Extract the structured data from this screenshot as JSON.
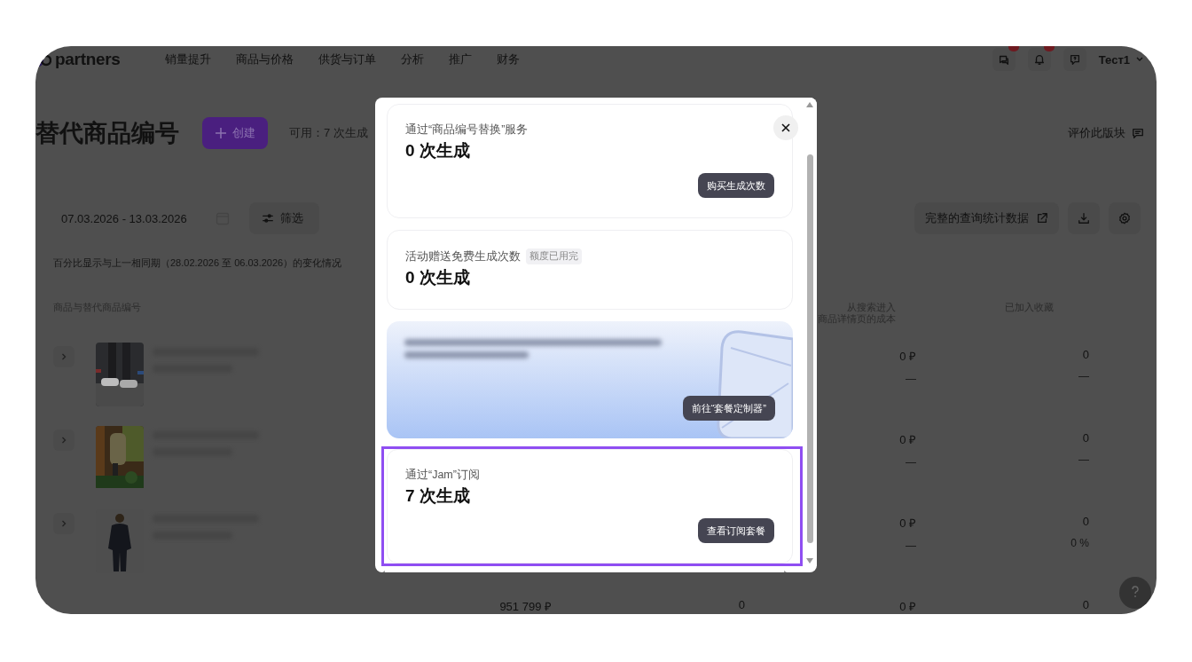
{
  "nav": {
    "logo": "partners",
    "items": [
      "销量提升",
      "商品与价格",
      "供货与订单",
      "分析",
      "推广",
      "财务"
    ],
    "user": "Тест1"
  },
  "page": {
    "title": "替代商品编号",
    "create_button": "创建",
    "available": "可用：7 次生成",
    "rate_link": "评价此版块"
  },
  "toolbar": {
    "date_range": "07.03.2026 - 13.03.2026",
    "filter_button": "筛选",
    "stats_button": "完整的查询统计数据"
  },
  "note": "百分比显示与上一相同期（28.02.2026 至 06.03.2026）的变化情况",
  "table": {
    "columns": [
      {
        "label": "商品与替代商品编号"
      },
      {
        "lines": [
          "从搜索进入",
          "商品详情页的成本"
        ]
      },
      {
        "label": "已加入收藏"
      }
    ],
    "rows": [
      {
        "cost": "0 ₽",
        "cost_change": "—",
        "favorites": "0",
        "favorites_change": "—"
      },
      {
        "cost": "0 ₽",
        "cost_change": "—",
        "favorites": "0",
        "favorites_change": "—"
      },
      {
        "cost": "0 ₽",
        "cost_change": "—",
        "favorites": "0",
        "favorites_change": "0 %"
      },
      {
        "column_4": "951 799 ₽",
        "column_5": "0",
        "cost": "0 ₽",
        "favorites": "0"
      }
    ]
  },
  "modal": {
    "cards": [
      {
        "kind": "balance",
        "label": "通过“商品编号替换”服务",
        "count": "0 次生成",
        "button": "购买生成次数",
        "highlighted": false
      },
      {
        "kind": "balance",
        "label": "活动赠送免费生成次数",
        "tag": "额度已用完",
        "count": "0 次生成",
        "highlighted": false
      },
      {
        "kind": "promo",
        "button": "前往“套餐定制器”",
        "highlighted": false
      },
      {
        "kind": "balance",
        "label": "通过“Jam”订阅",
        "count": "7 次生成",
        "button": "查看订阅套餐",
        "highlighted": true
      }
    ]
  }
}
